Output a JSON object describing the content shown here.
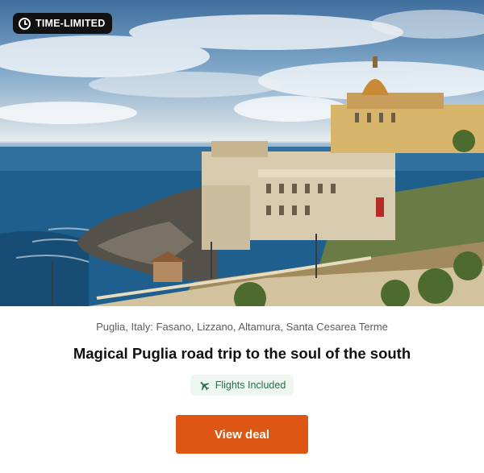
{
  "badge": {
    "label": "TIME-LIMITED",
    "icon": "clock-icon"
  },
  "hero": {
    "alt": "Santa Cesarea Terme coastline"
  },
  "location": "Puglia, Italy: Fasano, Lizzano, Altamura, Santa Cesarea Terme",
  "title": "Magical Puglia road trip to the soul of the south",
  "tag": {
    "label": "Flights Included",
    "icon": "airplane-icon"
  },
  "cta": {
    "label": "View deal"
  },
  "colors": {
    "accent": "#dd5613",
    "tag_text": "#26714a",
    "tag_bg": "#eef7f1",
    "badge_bg": "#111111"
  }
}
